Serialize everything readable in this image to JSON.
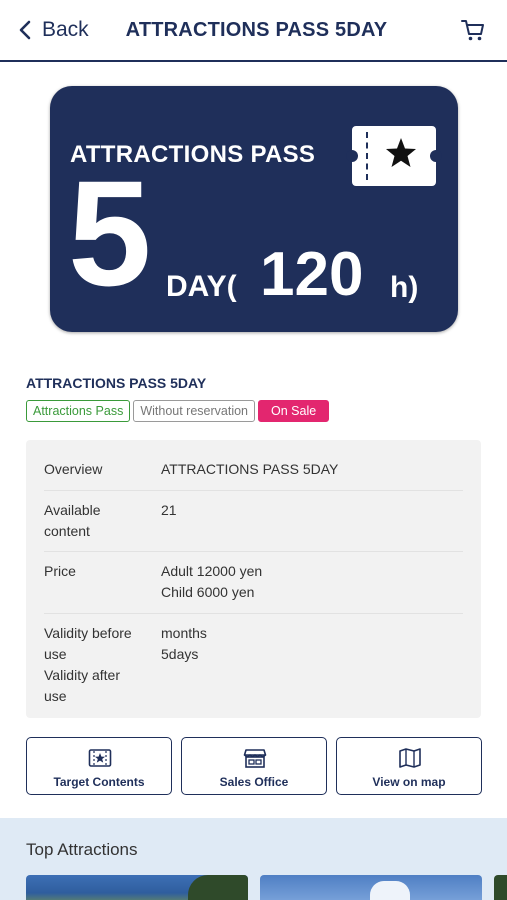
{
  "header": {
    "back_label": "Back",
    "title": "ATTRACTIONS PASS 5DAY",
    "cart_icon": "cart-icon"
  },
  "hero": {
    "pass_text": "ATTRACTIONS PASS",
    "days_number": "5",
    "day_text": "DAY(",
    "hours_number": "120",
    "hours_suffix": "h)",
    "ticket_icon": "ticket-star-icon",
    "background_color": "#1f2f5a"
  },
  "pass": {
    "name": "ATTRACTIONS PASS 5DAY",
    "badges": {
      "type": "Attractions Pass",
      "reservation": "Without reservation",
      "status": "On Sale"
    }
  },
  "info": {
    "overview_key": "Overview",
    "overview_value": "ATTRACTIONS PASS 5DAY",
    "available_key_1": "Available",
    "available_key_2": "content",
    "available_value": "21",
    "price_key": "Price",
    "price_adult": "Adult 12000 yen",
    "price_child": "Child 6000 yen",
    "validity_before_key_1": "Validity before",
    "validity_before_key_2": "use",
    "validity_after_key_1": "Validity after",
    "validity_after_key_2": "use",
    "validity_before_value": "months",
    "validity_after_value": "5days"
  },
  "actions": {
    "target_contents": "Target Contents",
    "sales_office": "Sales Office",
    "view_on_map": "View on map"
  },
  "top_attractions": {
    "heading": "Top Attractions"
  },
  "colors": {
    "navy": "#1f2f5a",
    "green": "#3a9a3a",
    "pink": "#e3266f",
    "light_blue_bg": "#dfeaf5"
  }
}
